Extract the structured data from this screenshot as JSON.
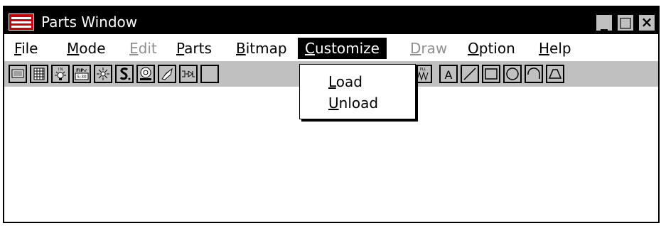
{
  "window": {
    "title": "Parts Window",
    "controls": {
      "minimize": "_",
      "maximize": "□",
      "close": "×"
    }
  },
  "menu": [
    {
      "key": "file",
      "label": "File",
      "accelerator": "F",
      "rest": "ile",
      "disabled": false
    },
    {
      "key": "mode",
      "label": "Mode",
      "accelerator": "M",
      "rest": "ode",
      "disabled": false
    },
    {
      "key": "edit",
      "label": "Edit",
      "accelerator": "E",
      "rest": "dit",
      "disabled": true
    },
    {
      "key": "parts",
      "label": "Parts",
      "accelerator": "P",
      "rest": "arts",
      "disabled": false
    },
    {
      "key": "bitmap",
      "label": "Bitmap",
      "accelerator": "B",
      "rest": "itmap",
      "disabled": false
    },
    {
      "key": "customize",
      "label": "Customize",
      "accelerator": "C",
      "rest": "ustomize",
      "disabled": false,
      "active": true
    },
    {
      "key": "draw",
      "label": "Draw",
      "accelerator": "D",
      "rest": "raw",
      "disabled": true
    },
    {
      "key": "option",
      "label": "Option",
      "accelerator": "O",
      "rest": "ption",
      "disabled": false
    },
    {
      "key": "help",
      "label": "Help",
      "accelerator": "H",
      "rest": "elp",
      "disabled": false
    }
  ],
  "dropdown": {
    "items": [
      {
        "label": "Load",
        "accelerator": "L",
        "rest": "oad"
      },
      {
        "label": "Unload",
        "accelerator": "U",
        "rest": "nload"
      }
    ]
  },
  "toolbar": {
    "icons": [
      "panel-icon",
      "grid-icon",
      "lamp-icon",
      "fip-display-icon",
      "light-icon",
      "rotary-icon",
      "speaker-icon",
      "pointer-icon",
      "drive-icon",
      "pll-icon",
      "text-icon",
      "line-icon",
      "rectangle-icon",
      "circle-icon",
      "arc-icon",
      "polygon-icon"
    ],
    "labels": {
      "lamp": "I N",
      "fip_top": "FIP↙",
      "fip_bottom": "5:30",
      "pll": "PLL",
      "text": "A"
    }
  },
  "colors": {
    "titlebar": "#000000",
    "window_face": "#c0c0c0",
    "menu_highlight": "#000000",
    "disabled_text": "#909090"
  }
}
